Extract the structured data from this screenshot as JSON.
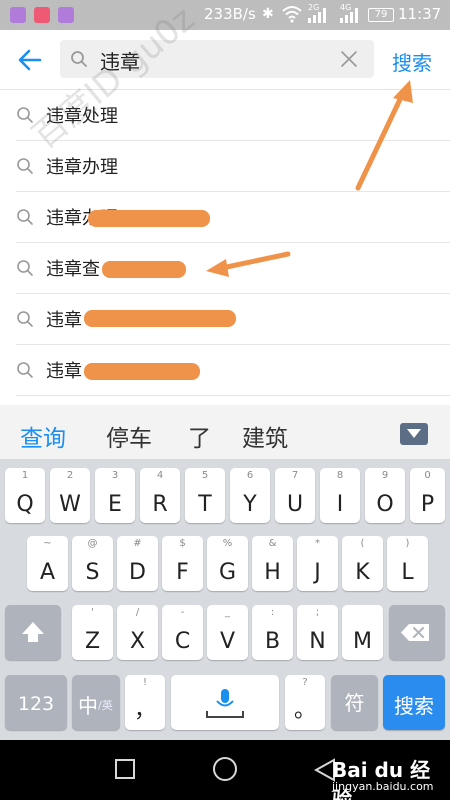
{
  "status_bar": {
    "speed": "233B/s",
    "tag_4g_left": "2G",
    "tag_4g_right": "4G",
    "battery": "79",
    "time": "11:37"
  },
  "search": {
    "query": "违章",
    "submit_label": "搜索"
  },
  "suggestions": [
    {
      "text": "违章处理"
    },
    {
      "text": "违章办理"
    },
    {
      "text": "违章办理"
    },
    {
      "text": "违章查"
    },
    {
      "text": "违章"
    },
    {
      "text": "违章"
    }
  ],
  "candidates": [
    "查询",
    "停车",
    "了",
    "建筑"
  ],
  "keyboard": {
    "row1": [
      {
        "main": "Q",
        "hint": "1"
      },
      {
        "main": "W",
        "hint": "2"
      },
      {
        "main": "E",
        "hint": "3"
      },
      {
        "main": "R",
        "hint": "4"
      },
      {
        "main": "T",
        "hint": "5"
      },
      {
        "main": "Y",
        "hint": "6"
      },
      {
        "main": "U",
        "hint": "7"
      },
      {
        "main": "I",
        "hint": "8"
      },
      {
        "main": "O",
        "hint": "9"
      },
      {
        "main": "P",
        "hint": "0"
      }
    ],
    "row2": [
      {
        "main": "A",
        "hint": "~"
      },
      {
        "main": "S",
        "hint": "@"
      },
      {
        "main": "D",
        "hint": "#"
      },
      {
        "main": "F",
        "hint": "$"
      },
      {
        "main": "G",
        "hint": "%"
      },
      {
        "main": "H",
        "hint": "&"
      },
      {
        "main": "J",
        "hint": "*"
      },
      {
        "main": "K",
        "hint": "("
      },
      {
        "main": "L",
        "hint": ")"
      }
    ],
    "row3": [
      {
        "main": "Z",
        "hint": "'"
      },
      {
        "main": "X",
        "hint": "/"
      },
      {
        "main": "C",
        "hint": "-"
      },
      {
        "main": "V",
        "hint": "_"
      },
      {
        "main": "B",
        "hint": ":"
      },
      {
        "main": "N",
        "hint": ";"
      },
      {
        "main": "M",
        "hint": ""
      }
    ],
    "num_label": "123",
    "lang_label": "中",
    "lang_sub": "/英",
    "comma": "，",
    "comma_hint": "!",
    "period": "。",
    "period_hint": "?",
    "symbol_label": "符",
    "search_label": "搜索"
  },
  "watermark": "百度ID gu0z",
  "logo": {
    "text": "Bai du 经验",
    "url": "jingyan.baidu.com"
  },
  "colors": {
    "accent": "#1a8ff0",
    "annotation": "#f0934a"
  }
}
